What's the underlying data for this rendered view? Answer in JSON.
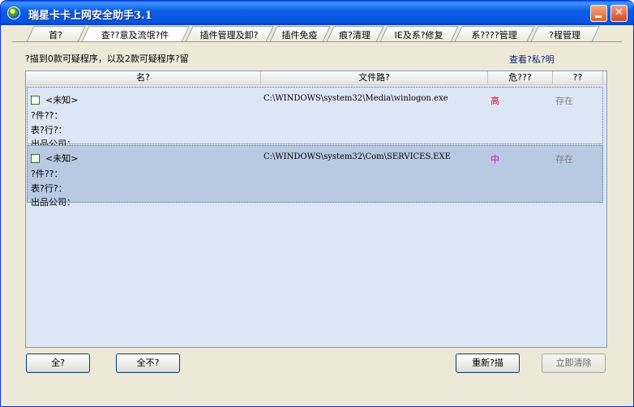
{
  "window": {
    "title": "瑞星卡卡上网安全助手3.1"
  },
  "tabs": [
    {
      "label": "首?"
    },
    {
      "label": "查??意及流氓?件"
    },
    {
      "label": "插件管理及卸?"
    },
    {
      "label": "插件免疫"
    },
    {
      "label": "痕?清理"
    },
    {
      "label": "IE及系?修复"
    },
    {
      "label": "系????管理"
    },
    {
      "label": "?程管理"
    }
  ],
  "scan": {
    "summary": "?描到0款可疑程序，以及2款可疑程序?留",
    "privacy_link": "查看?私?明"
  },
  "table": {
    "headers": {
      "name": "名?",
      "path": "文件路?",
      "risk": "危???",
      "status": "??"
    },
    "rows": [
      {
        "name": "<未知>",
        "path": "C:\\WINDOWS\\system32\\Media\\winlogon.exe",
        "risk": "高",
        "risk_color": "#e4002b",
        "status": "存在",
        "meta1": "?件??：",
        "meta2": "表?行?：",
        "meta3": "出品公司："
      },
      {
        "name": "<未知>",
        "path": "C:\\WINDOWS\\system32\\Com\\SERVICES.EXE",
        "risk": "中",
        "risk_color": "#e000c8",
        "status": "存在",
        "meta1": "?件??：",
        "meta2": "表?行?：",
        "meta3": "出品公司："
      }
    ]
  },
  "buttons": {
    "select_all": "全?",
    "select_none": "全不?",
    "rescan": "重新?描",
    "clear_now": "立即清除"
  }
}
